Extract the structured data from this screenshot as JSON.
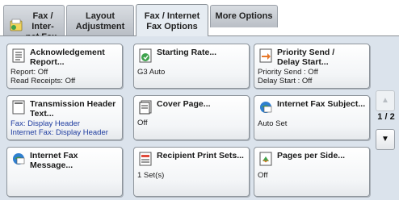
{
  "tabs": [
    {
      "line1": "Fax / Inter-",
      "line2": "net Fax"
    },
    {
      "line1": "Layout",
      "line2": "Adjustment"
    },
    {
      "line1": "Fax / Internet",
      "line2": "Fax Options"
    },
    {
      "line1": "More Options",
      "line2": ""
    }
  ],
  "active_tab": 2,
  "cards": [
    {
      "title1": "Acknowledgement",
      "title2": "Report...",
      "val1": "Report: Off",
      "val2": "Read Receipts: Off",
      "icon": "report-icon"
    },
    {
      "title1": "Starting Rate...",
      "title2": "",
      "val1": "G3 Auto",
      "val2": "",
      "icon": "starting-rate-icon"
    },
    {
      "title1": "Priority Send /",
      "title2": "Delay Start...",
      "val1": "Priority Send : Off",
      "val2": "Delay Start : Off",
      "icon": "priority-send-icon"
    },
    {
      "title1": "Transmission Header",
      "title2": "Text...",
      "val1": "Fax: Display Header",
      "val2": "Internet Fax: Display Header",
      "icon": "transmission-header-icon"
    },
    {
      "title1": "Cover Page...",
      "title2": "",
      "val1": "Off",
      "val2": "",
      "icon": "cover-page-icon"
    },
    {
      "title1": "Internet Fax Subject...",
      "title2": "",
      "val1": "Auto Set",
      "val2": "",
      "icon": "internet-fax-subject-icon"
    },
    {
      "title1": "Internet Fax",
      "title2": "Message...",
      "val1": "",
      "val2": "",
      "icon": "internet-fax-message-icon"
    },
    {
      "title1": "Recipient Print Sets...",
      "title2": "",
      "val1": "1 Set(s)",
      "val2": "",
      "icon": "recipient-print-sets-icon"
    },
    {
      "title1": "Pages per Side...",
      "title2": "",
      "val1": "Off",
      "val2": "",
      "icon": "pages-per-side-icon"
    }
  ],
  "pager": {
    "indicator": "1 / 2",
    "up": "▲",
    "down": "▼"
  },
  "colors": {
    "blue_value": "#1c3a9e",
    "panel": "#dbe3ec"
  }
}
